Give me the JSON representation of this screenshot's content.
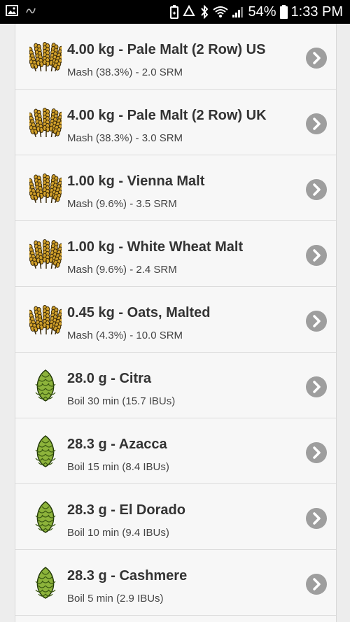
{
  "status_bar": {
    "left_icons": [
      "image-notification-icon",
      "music-notification-icon"
    ],
    "right_icons": [
      "battery-saver-icon",
      "recycle-icon",
      "bluetooth-icon",
      "wifi-icon",
      "signal-icon"
    ],
    "battery_percent": "54%",
    "time": "1:33 PM"
  },
  "ingredients": [
    {
      "kind": "grain",
      "icon": "malt-grain-icon",
      "title": "4.00 kg - Pale Malt (2 Row) US",
      "subtitle": "Mash (38.3%) - 2.0 SRM"
    },
    {
      "kind": "grain",
      "icon": "malt-grain-icon",
      "title": "4.00 kg - Pale Malt (2 Row) UK",
      "subtitle": "Mash (38.3%) - 3.0 SRM"
    },
    {
      "kind": "grain",
      "icon": "malt-grain-icon",
      "title": "1.00 kg - Vienna Malt",
      "subtitle": "Mash (9.6%) - 3.5 SRM"
    },
    {
      "kind": "grain",
      "icon": "malt-grain-icon",
      "title": "1.00 kg - White Wheat Malt",
      "subtitle": "Mash (9.6%) - 2.4 SRM"
    },
    {
      "kind": "grain",
      "icon": "malt-grain-icon",
      "title": "0.45 kg - Oats, Malted",
      "subtitle": "Mash (4.3%) - 10.0 SRM"
    },
    {
      "kind": "hop",
      "icon": "hop-cone-icon",
      "title": "28.0 g - Citra",
      "subtitle": "Boil 30 min (15.7 IBUs)"
    },
    {
      "kind": "hop",
      "icon": "hop-cone-icon",
      "title": "28.3 g - Azacca",
      "subtitle": "Boil 15 min (8.4 IBUs)"
    },
    {
      "kind": "hop",
      "icon": "hop-cone-icon",
      "title": "28.3 g - El Dorado",
      "subtitle": "Boil 10 min (9.4 IBUs)"
    },
    {
      "kind": "hop",
      "icon": "hop-cone-icon",
      "title": "28.3 g - Cashmere",
      "subtitle": "Boil 5 min (2.9 IBUs)"
    }
  ],
  "colors": {
    "status_bar": "#000000",
    "background": "#ededed",
    "row": "#f7f7f7",
    "chevron": "#9e9e9e",
    "grain": "#d2a12b",
    "hop": "#8db33b"
  }
}
